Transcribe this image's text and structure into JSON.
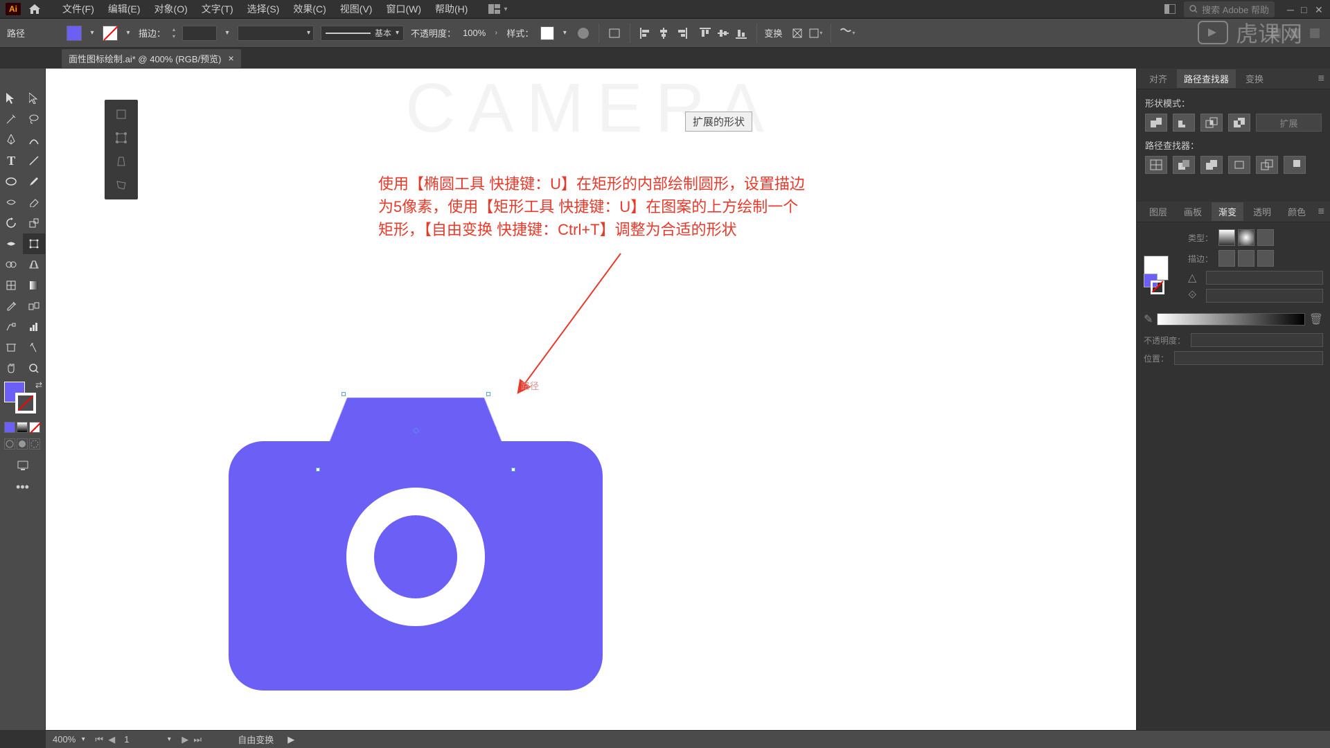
{
  "menubar": {
    "logo": "Ai",
    "items": [
      "文件(F)",
      "编辑(E)",
      "对象(O)",
      "文字(T)",
      "选择(S)",
      "效果(C)",
      "视图(V)",
      "窗口(W)",
      "帮助(H)"
    ],
    "search_placeholder": "搜索 Adobe 帮助"
  },
  "controlbar": {
    "mode": "路径",
    "stroke_label": "描边：",
    "stroke_style_label": "基本",
    "opacity_label": "不透明度：",
    "opacity_value": "100%",
    "style_label": "样式：",
    "transform_label": "变换",
    "fill_color": "#6b5ff5"
  },
  "tab": {
    "title": "面性图标绘制.ai* @ 400% (RGB/预览)"
  },
  "canvas": {
    "header_text": "CAMERA",
    "annotation_button": "扩展的形状",
    "instruction_line1": "使用【椭圆工具 快捷键：U】在矩形的内部绘制圆形，设置描边",
    "instruction_line2": "为5像素，使用【矩形工具 快捷键：U】在图案的上方绘制一个",
    "instruction_line3": "矩形，【自由变换 快捷键：Ctrl+T】调整为合适的形状",
    "path_label": "路径"
  },
  "panels": {
    "align_tab": "对齐",
    "pathfinder_tab": "路径查找器",
    "transform_tab": "变换",
    "shape_mode_label": "形状模式：",
    "pathfinder_label": "路径查找器：",
    "expand_label": "扩展",
    "layers_tab": "图层",
    "artboards_tab": "画板",
    "gradient_tab": "渐变",
    "transparency_tab": "透明",
    "color_tab": "颜色",
    "type_label": "类型：",
    "stroke_grad_label": "描边：",
    "opacity_grad_label": "不透明度：",
    "position_label": "位置："
  },
  "statusbar": {
    "zoom": "400%",
    "page": "1",
    "tool": "自由变换"
  },
  "watermark": "虎课网"
}
